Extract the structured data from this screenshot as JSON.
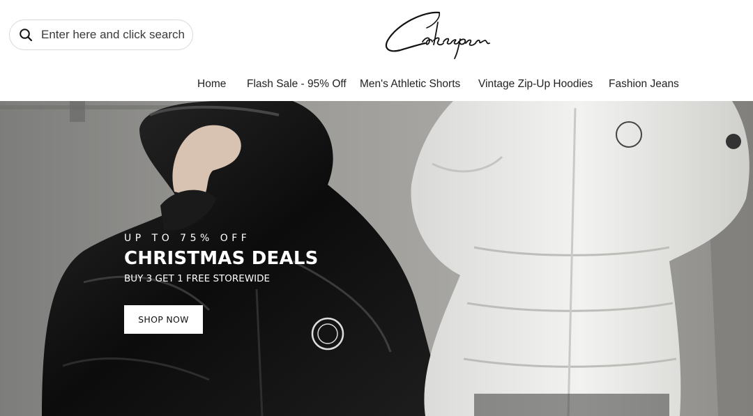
{
  "header": {
    "search": {
      "placeholder": "Enter here and click search",
      "icon": "search-icon"
    },
    "logo_text": "Cakespen"
  },
  "nav": {
    "items": [
      {
        "label": "Home"
      },
      {
        "label": "Flash Sale - 95% Off"
      },
      {
        "label": "Men's Athletic Shorts"
      },
      {
        "label": "Vintage Zip-Up Hoodies"
      },
      {
        "label": "Fashion Jeans"
      }
    ]
  },
  "hero": {
    "eyebrow": "UP TO 75% OFF",
    "title": "CHRISTMAS DEALS",
    "subtitle": "BUY 3 GET 1 FREE STOREWIDE",
    "cta_label": "SHOP NOW"
  },
  "colors": {
    "text": "#222222",
    "hero_text": "#ffffff",
    "button_bg": "#ffffff"
  }
}
